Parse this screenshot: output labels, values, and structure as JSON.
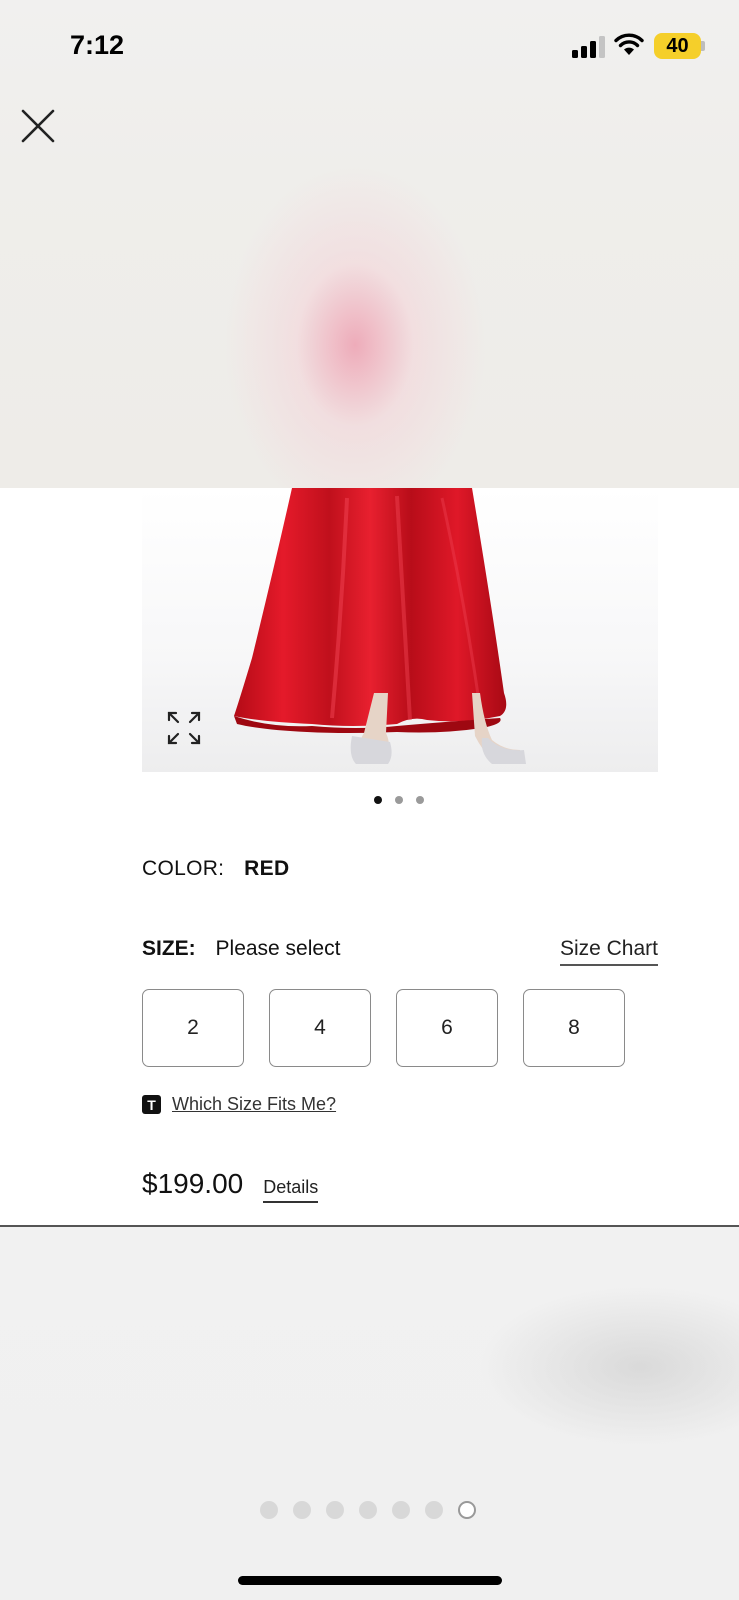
{
  "status_bar": {
    "time": "7:12",
    "battery": "40"
  },
  "product": {
    "color_label": "COLOR:",
    "color_value": "RED",
    "size_label": "SIZE:",
    "size_prompt": "Please select",
    "size_chart": "Size Chart",
    "sizes": [
      "2",
      "4",
      "6",
      "8"
    ],
    "fit_badge": "T",
    "fit_link": "Which Size Fits Me?",
    "price": "$199.00",
    "details": "Details",
    "image_dots": {
      "count": 3,
      "active_index": 0
    }
  },
  "page_dots": {
    "count": 7,
    "active_index": 6
  },
  "colors": {
    "dress": "#c8101c",
    "accent": "#111111",
    "battery": "#f5cf2a"
  }
}
